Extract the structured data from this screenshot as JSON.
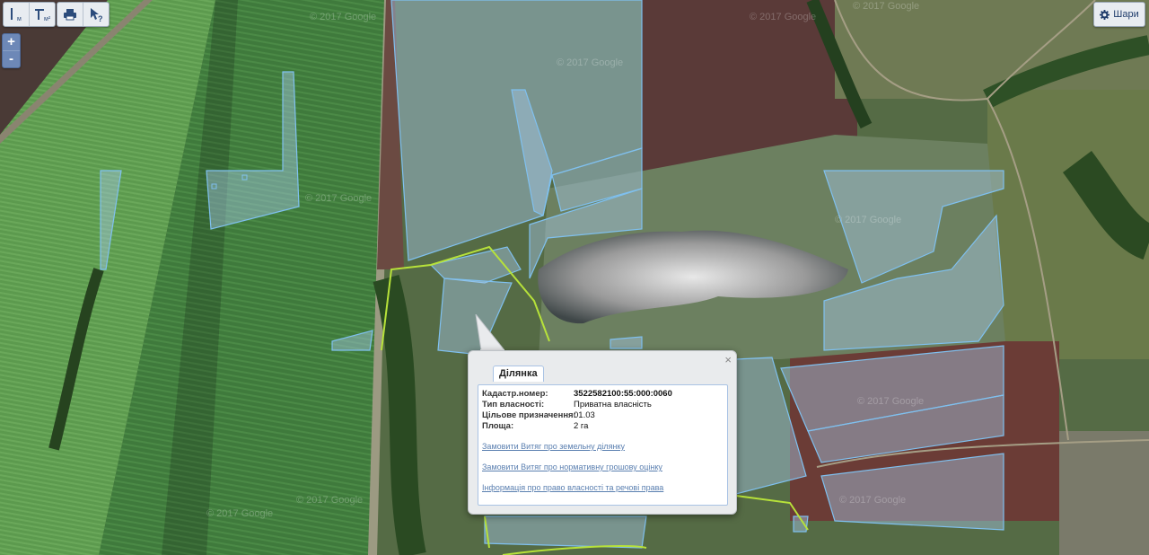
{
  "toolbar": {
    "measure_line_icon": "ruler-line-icon",
    "measure_area_icon": "ruler-area-icon",
    "measure_line_sub": "м",
    "measure_area_sub": "м²",
    "print_icon": "printer-icon",
    "identify_icon": "identify-cursor-icon"
  },
  "zoom": {
    "in_label": "+",
    "out_label": "-"
  },
  "layers": {
    "label": "Шари",
    "icon": "gear-icon"
  },
  "map": {
    "watermark": "© 2017 Google"
  },
  "popup": {
    "tab_label": "Ділянка",
    "close_label": "×",
    "fields": [
      {
        "label": "Кадастр.номер:",
        "value": "3522582100:55:000:0060"
      },
      {
        "label": "Тип власності:",
        "value": "Приватна власність"
      },
      {
        "label": "Цільове призначення:",
        "value": "01.03"
      },
      {
        "label": "Площа:",
        "value": "2 га"
      }
    ],
    "links": [
      "Замовити Витяг про земельну ділянку",
      "Замовити Витяг про нормативну грошову оцінку",
      "Інформація про право власності та речові права"
    ]
  }
}
